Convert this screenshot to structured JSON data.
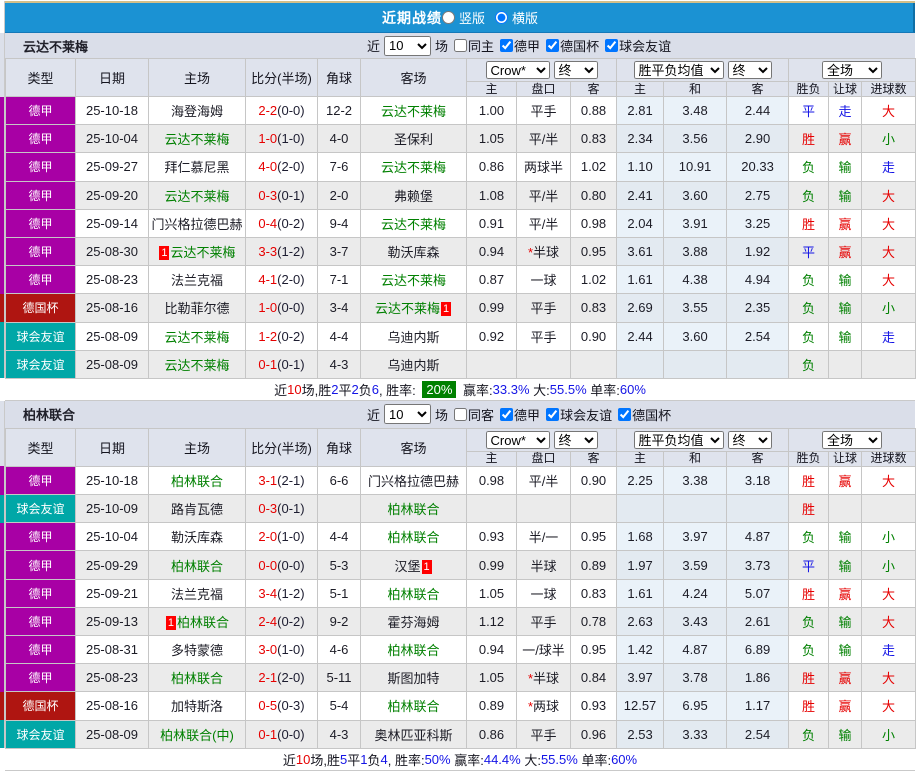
{
  "title_bar": {
    "title": "近期战绩",
    "options": [
      {
        "label": "竖版",
        "selected": false
      },
      {
        "label": "横版",
        "selected": true
      }
    ]
  },
  "table_columns": {
    "main": [
      "类型",
      "日期",
      "主场",
      "比分(半场)",
      "角球",
      "客场"
    ],
    "sub": [
      "主",
      "盘口",
      "客",
      "主",
      "和",
      "客",
      "胜负",
      "让球",
      "进球数"
    ],
    "selects": {
      "bookmaker": "Crow*",
      "bookmaker_final": "终",
      "average": "胜平负均值",
      "average_final": "终",
      "scope": "全场"
    }
  },
  "colors": {
    "title_bar_bg": "#1b92d3",
    "highlight_team": "#008000",
    "score": "#e60000",
    "rate_badge_bg": "#008000",
    "league": {
      "德甲": "#a800a5",
      "德国杯": "#af1511",
      "球会友谊": "#00a7a7"
    },
    "outcome": {
      "胜": "red",
      "赢": "red",
      "大": "red",
      "负": "green",
      "输": "green",
      "小": "green",
      "平": "blue",
      "走": "blue"
    }
  },
  "sections": [
    {
      "team": "云达不莱梅",
      "filters": {
        "recent_label": "近",
        "count": "10",
        "matches_label": "场",
        "venue_label": "同主",
        "venue_checked": false,
        "leagues": [
          {
            "label": "德甲",
            "checked": true
          },
          {
            "label": "德国杯",
            "checked": true
          },
          {
            "label": "球会友谊",
            "checked": true
          }
        ]
      },
      "rows": [
        {
          "league": "德甲",
          "date": "25-10-18",
          "home": "海登海姆",
          "home_hl": false,
          "home_red": "",
          "score": "2-2",
          "half": "(0-0)",
          "corners": "12-2",
          "away": "云达不莱梅",
          "away_hl": true,
          "away_red": "",
          "water_home": "1.00",
          "handicap": "平手",
          "handicap_star": false,
          "water_away": "0.88",
          "avg_home": "2.81",
          "avg_draw": "3.48",
          "avg_away": "2.44",
          "outcome": "平",
          "handicap_outcome": "走",
          "goals_outcome": "大"
        },
        {
          "league": "德甲",
          "date": "25-10-04",
          "home": "云达不莱梅",
          "home_hl": true,
          "home_red": "",
          "score": "1-0",
          "half": "(1-0)",
          "corners": "4-0",
          "away": "圣保利",
          "away_hl": false,
          "away_red": "",
          "water_home": "1.05",
          "handicap": "平/半",
          "handicap_star": false,
          "water_away": "0.83",
          "avg_home": "2.34",
          "avg_draw": "3.56",
          "avg_away": "2.90",
          "outcome": "胜",
          "handicap_outcome": "赢",
          "goals_outcome": "小"
        },
        {
          "league": "德甲",
          "date": "25-09-27",
          "home": "拜仁慕尼黑",
          "home_hl": false,
          "home_red": "",
          "score": "4-0",
          "half": "(2-0)",
          "corners": "7-6",
          "away": "云达不莱梅",
          "away_hl": true,
          "away_red": "",
          "water_home": "0.86",
          "handicap": "两球半",
          "handicap_star": false,
          "water_away": "1.02",
          "avg_home": "1.10",
          "avg_draw": "10.91",
          "avg_away": "20.33",
          "outcome": "负",
          "handicap_outcome": "输",
          "goals_outcome": "走"
        },
        {
          "league": "德甲",
          "date": "25-09-20",
          "home": "云达不莱梅",
          "home_hl": true,
          "home_red": "",
          "score": "0-3",
          "half": "(0-1)",
          "corners": "2-0",
          "away": "弗赖堡",
          "away_hl": false,
          "away_red": "",
          "water_home": "1.08",
          "handicap": "平/半",
          "handicap_star": false,
          "water_away": "0.80",
          "avg_home": "2.41",
          "avg_draw": "3.60",
          "avg_away": "2.75",
          "outcome": "负",
          "handicap_outcome": "输",
          "goals_outcome": "大"
        },
        {
          "league": "德甲",
          "date": "25-09-14",
          "home": "门兴格拉德巴赫",
          "home_hl": false,
          "home_red": "",
          "score": "0-4",
          "half": "(0-2)",
          "corners": "9-4",
          "away": "云达不莱梅",
          "away_hl": true,
          "away_red": "",
          "water_home": "0.91",
          "handicap": "平/半",
          "handicap_star": false,
          "water_away": "0.98",
          "avg_home": "2.04",
          "avg_draw": "3.91",
          "avg_away": "3.25",
          "outcome": "胜",
          "handicap_outcome": "赢",
          "goals_outcome": "大"
        },
        {
          "league": "德甲",
          "date": "25-08-30",
          "home": "云达不莱梅",
          "home_hl": true,
          "home_red": "1",
          "score": "3-3",
          "half": "(1-2)",
          "corners": "3-7",
          "away": "勒沃库森",
          "away_hl": false,
          "away_red": "",
          "water_home": "0.94",
          "handicap": "半球",
          "handicap_star": true,
          "water_away": "0.95",
          "avg_home": "3.61",
          "avg_draw": "3.88",
          "avg_away": "1.92",
          "outcome": "平",
          "handicap_outcome": "赢",
          "goals_outcome": "大"
        },
        {
          "league": "德甲",
          "date": "25-08-23",
          "home": "法兰克福",
          "home_hl": false,
          "home_red": "",
          "score": "4-1",
          "half": "(2-0)",
          "corners": "7-1",
          "away": "云达不莱梅",
          "away_hl": true,
          "away_red": "",
          "water_home": "0.87",
          "handicap": "一球",
          "handicap_star": false,
          "water_away": "1.02",
          "avg_home": "1.61",
          "avg_draw": "4.38",
          "avg_away": "4.94",
          "outcome": "负",
          "handicap_outcome": "输",
          "goals_outcome": "大"
        },
        {
          "league": "德国杯",
          "date": "25-08-16",
          "home": "比勒菲尔德",
          "home_hl": false,
          "home_red": "",
          "score": "1-0",
          "half": "(0-0)",
          "corners": "3-4",
          "away": "云达不莱梅",
          "away_hl": true,
          "away_red": "1",
          "water_home": "0.99",
          "handicap": "平手",
          "handicap_star": false,
          "water_away": "0.83",
          "avg_home": "2.69",
          "avg_draw": "3.55",
          "avg_away": "2.35",
          "outcome": "负",
          "handicap_outcome": "输",
          "goals_outcome": "小"
        },
        {
          "league": "球会友谊",
          "date": "25-08-09",
          "home": "云达不莱梅",
          "home_hl": true,
          "home_red": "",
          "score": "1-2",
          "half": "(0-2)",
          "corners": "4-4",
          "away": "乌迪内斯",
          "away_hl": false,
          "away_red": "",
          "water_home": "0.92",
          "handicap": "平手",
          "handicap_star": false,
          "water_away": "0.90",
          "avg_home": "2.44",
          "avg_draw": "3.60",
          "avg_away": "2.54",
          "outcome": "负",
          "handicap_outcome": "输",
          "goals_outcome": "走"
        },
        {
          "league": "球会友谊",
          "date": "25-08-09",
          "home": "云达不莱梅",
          "home_hl": true,
          "home_red": "",
          "score": "0-1",
          "half": "(0-1)",
          "corners": "4-3",
          "away": "乌迪内斯",
          "away_hl": false,
          "away_red": "",
          "water_home": "",
          "handicap": "",
          "handicap_star": false,
          "water_away": "",
          "avg_home": "",
          "avg_draw": "",
          "avg_away": "",
          "outcome": "负",
          "handicap_outcome": "",
          "goals_outcome": ""
        }
      ],
      "summary": [
        {
          "t": "近"
        },
        {
          "t": "10",
          "c": "r"
        },
        {
          "t": "场,胜"
        },
        {
          "t": "2",
          "c": "b"
        },
        {
          "t": "平"
        },
        {
          "t": "2",
          "c": "b"
        },
        {
          "t": "负"
        },
        {
          "t": "6",
          "c": "b"
        },
        {
          "t": ", 胜率: "
        },
        {
          "t": "20%",
          "badge": true
        },
        {
          "t": " 赢率:"
        },
        {
          "t": "33.3%",
          "c": "b"
        },
        {
          "t": " 大:"
        },
        {
          "t": "55.5%",
          "c": "b"
        },
        {
          "t": " 单率:"
        },
        {
          "t": "60%",
          "c": "b"
        }
      ]
    },
    {
      "team": "柏林联合",
      "filters": {
        "recent_label": "近",
        "count": "10",
        "matches_label": "场",
        "venue_label": "同客",
        "venue_checked": false,
        "leagues": [
          {
            "label": "德甲",
            "checked": true
          },
          {
            "label": "球会友谊",
            "checked": true
          },
          {
            "label": "德国杯",
            "checked": true
          }
        ]
      },
      "rows": [
        {
          "league": "德甲",
          "date": "25-10-18",
          "home": "柏林联合",
          "home_hl": true,
          "home_red": "",
          "score": "3-1",
          "half": "(2-1)",
          "corners": "6-6",
          "away": "门兴格拉德巴赫",
          "away_hl": false,
          "away_red": "",
          "water_home": "0.98",
          "handicap": "平/半",
          "handicap_star": false,
          "water_away": "0.90",
          "avg_home": "2.25",
          "avg_draw": "3.38",
          "avg_away": "3.18",
          "outcome": "胜",
          "handicap_outcome": "赢",
          "goals_outcome": "大"
        },
        {
          "league": "球会友谊",
          "date": "25-10-09",
          "home": "路肯瓦德",
          "home_hl": false,
          "home_red": "",
          "score": "0-3",
          "half": "(0-1)",
          "corners": "",
          "away": "柏林联合",
          "away_hl": true,
          "away_red": "",
          "water_home": "",
          "handicap": "",
          "handicap_star": false,
          "water_away": "",
          "avg_home": "",
          "avg_draw": "",
          "avg_away": "",
          "outcome": "胜",
          "handicap_outcome": "",
          "goals_outcome": ""
        },
        {
          "league": "德甲",
          "date": "25-10-04",
          "home": "勒沃库森",
          "home_hl": false,
          "home_red": "",
          "score": "2-0",
          "half": "(1-0)",
          "corners": "4-4",
          "away": "柏林联合",
          "away_hl": true,
          "away_red": "",
          "water_home": "0.93",
          "handicap": "半/一",
          "handicap_star": false,
          "water_away": "0.95",
          "avg_home": "1.68",
          "avg_draw": "3.97",
          "avg_away": "4.87",
          "outcome": "负",
          "handicap_outcome": "输",
          "goals_outcome": "小"
        },
        {
          "league": "德甲",
          "date": "25-09-29",
          "home": "柏林联合",
          "home_hl": true,
          "home_red": "",
          "score": "0-0",
          "half": "(0-0)",
          "corners": "5-3",
          "away": "汉堡",
          "away_hl": false,
          "away_red": "1",
          "water_home": "0.99",
          "handicap": "半球",
          "handicap_star": false,
          "water_away": "0.89",
          "avg_home": "1.97",
          "avg_draw": "3.59",
          "avg_away": "3.73",
          "outcome": "平",
          "handicap_outcome": "输",
          "goals_outcome": "小"
        },
        {
          "league": "德甲",
          "date": "25-09-21",
          "home": "法兰克福",
          "home_hl": false,
          "home_red": "",
          "score": "3-4",
          "half": "(1-2)",
          "corners": "5-1",
          "away": "柏林联合",
          "away_hl": true,
          "away_red": "",
          "water_home": "1.05",
          "handicap": "一球",
          "handicap_star": false,
          "water_away": "0.83",
          "avg_home": "1.61",
          "avg_draw": "4.24",
          "avg_away": "5.07",
          "outcome": "胜",
          "handicap_outcome": "赢",
          "goals_outcome": "大"
        },
        {
          "league": "德甲",
          "date": "25-09-13",
          "home": "柏林联合",
          "home_hl": true,
          "home_red": "1",
          "score": "2-4",
          "half": "(0-2)",
          "corners": "9-2",
          "away": "霍芬海姆",
          "away_hl": false,
          "away_red": "",
          "water_home": "1.12",
          "handicap": "平手",
          "handicap_star": false,
          "water_away": "0.78",
          "avg_home": "2.63",
          "avg_draw": "3.43",
          "avg_away": "2.61",
          "outcome": "负",
          "handicap_outcome": "输",
          "goals_outcome": "大"
        },
        {
          "league": "德甲",
          "date": "25-08-31",
          "home": "多特蒙德",
          "home_hl": false,
          "home_red": "",
          "score": "3-0",
          "half": "(1-0)",
          "corners": "4-6",
          "away": "柏林联合",
          "away_hl": true,
          "away_red": "",
          "water_home": "0.94",
          "handicap": "一/球半",
          "handicap_star": false,
          "water_away": "0.95",
          "avg_home": "1.42",
          "avg_draw": "4.87",
          "avg_away": "6.89",
          "outcome": "负",
          "handicap_outcome": "输",
          "goals_outcome": "走"
        },
        {
          "league": "德甲",
          "date": "25-08-23",
          "home": "柏林联合",
          "home_hl": true,
          "home_red": "",
          "score": "2-1",
          "half": "(2-0)",
          "corners": "5-11",
          "away": "斯图加特",
          "away_hl": false,
          "away_red": "",
          "water_home": "1.05",
          "handicap": "半球",
          "handicap_star": true,
          "water_away": "0.84",
          "avg_home": "3.97",
          "avg_draw": "3.78",
          "avg_away": "1.86",
          "outcome": "胜",
          "handicap_outcome": "赢",
          "goals_outcome": "大"
        },
        {
          "league": "德国杯",
          "date": "25-08-16",
          "home": "加特斯洛",
          "home_hl": false,
          "home_red": "",
          "score": "0-5",
          "half": "(0-3)",
          "corners": "5-4",
          "away": "柏林联合",
          "away_hl": true,
          "away_red": "",
          "water_home": "0.89",
          "handicap": "两球",
          "handicap_star": true,
          "water_away": "0.93",
          "avg_home": "12.57",
          "avg_draw": "6.95",
          "avg_away": "1.17",
          "outcome": "胜",
          "handicap_outcome": "赢",
          "goals_outcome": "大"
        },
        {
          "league": "球会友谊",
          "date": "25-08-09",
          "home": "柏林联合(中)",
          "home_hl": true,
          "home_red": "",
          "score": "0-1",
          "half": "(0-0)",
          "corners": "4-3",
          "away": "奥林匹亚科斯",
          "away_hl": false,
          "away_red": "",
          "water_home": "0.86",
          "handicap": "平手",
          "handicap_star": false,
          "water_away": "0.96",
          "avg_home": "2.53",
          "avg_draw": "3.33",
          "avg_away": "2.54",
          "outcome": "负",
          "handicap_outcome": "输",
          "goals_outcome": "小"
        }
      ],
      "summary": [
        {
          "t": "近"
        },
        {
          "t": "10",
          "c": "r"
        },
        {
          "t": "场,胜"
        },
        {
          "t": "5",
          "c": "b"
        },
        {
          "t": "平"
        },
        {
          "t": "1",
          "c": "b"
        },
        {
          "t": "负"
        },
        {
          "t": "4",
          "c": "b"
        },
        {
          "t": ", 胜率:"
        },
        {
          "t": "50%",
          "c": "b"
        },
        {
          "t": " 赢率:"
        },
        {
          "t": "44.4%",
          "c": "b"
        },
        {
          "t": " 大:"
        },
        {
          "t": "55.5%",
          "c": "b"
        },
        {
          "t": " 单率:"
        },
        {
          "t": "60%",
          "c": "b"
        }
      ]
    }
  ]
}
